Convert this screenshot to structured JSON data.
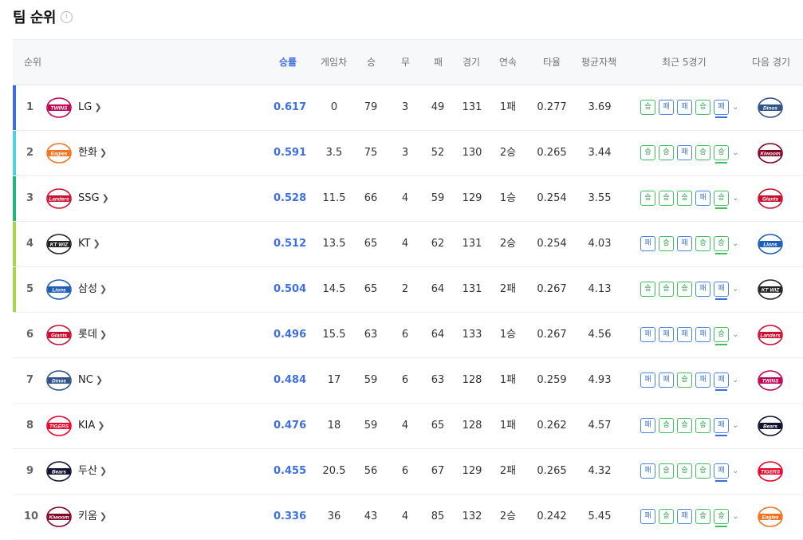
{
  "title": "팀 순위",
  "headers": {
    "rank": "순위",
    "pct": "승률",
    "gb": "게임차",
    "w": "승",
    "d": "무",
    "l": "패",
    "g": "경기",
    "streak": "연속",
    "avg": "타율",
    "era": "평균자책",
    "recent": "최근 5경기",
    "next": "다음 경기"
  },
  "win_label": "승",
  "loss_label": "패",
  "teams": [
    {
      "rank": "1",
      "name": "LG",
      "pct": "0.617",
      "gb": "0",
      "w": "79",
      "d": "3",
      "l": "49",
      "g": "131",
      "streak": "1패",
      "avg": "0.277",
      "era": "3.69",
      "logo": "TWINS",
      "next_logo": "Dinos"
    },
    {
      "rank": "2",
      "name": "한화",
      "pct": "0.591",
      "gb": "3.5",
      "w": "75",
      "d": "3",
      "l": "52",
      "g": "130",
      "streak": "2승",
      "avg": "0.265",
      "era": "3.44",
      "logo": "Eagles",
      "next_logo": "Kiwoom"
    },
    {
      "rank": "3",
      "name": "SSG",
      "pct": "0.528",
      "gb": "11.5",
      "w": "66",
      "d": "4",
      "l": "59",
      "g": "129",
      "streak": "1승",
      "avg": "0.254",
      "era": "3.55",
      "logo": "Landers",
      "next_logo": "Giants"
    },
    {
      "rank": "4",
      "name": "KT",
      "pct": "0.512",
      "gb": "13.5",
      "w": "65",
      "d": "4",
      "l": "62",
      "g": "131",
      "streak": "2승",
      "avg": "0.254",
      "era": "4.03",
      "logo": "KT WIZ",
      "next_logo": "Lions"
    },
    {
      "rank": "5",
      "name": "삼성",
      "pct": "0.504",
      "gb": "14.5",
      "w": "65",
      "d": "2",
      "l": "64",
      "g": "131",
      "streak": "2패",
      "avg": "0.267",
      "era": "4.13",
      "logo": "Lions",
      "next_logo": "KT WIZ"
    },
    {
      "rank": "6",
      "name": "롯데",
      "pct": "0.496",
      "gb": "15.5",
      "w": "63",
      "d": "6",
      "l": "64",
      "g": "133",
      "streak": "1승",
      "avg": "0.267",
      "era": "4.56",
      "logo": "Giants",
      "next_logo": "Landers"
    },
    {
      "rank": "7",
      "name": "NC",
      "pct": "0.484",
      "gb": "17",
      "w": "59",
      "d": "6",
      "l": "63",
      "g": "128",
      "streak": "1패",
      "avg": "0.259",
      "era": "4.93",
      "logo": "Dinos",
      "next_logo": "TWINS"
    },
    {
      "rank": "8",
      "name": "KIA",
      "pct": "0.476",
      "gb": "18",
      "w": "59",
      "d": "4",
      "l": "65",
      "g": "128",
      "streak": "1패",
      "avg": "0.262",
      "era": "4.57",
      "logo": "TIGERS",
      "next_logo": "Bears"
    },
    {
      "rank": "9",
      "name": "두산",
      "pct": "0.455",
      "gb": "20.5",
      "w": "56",
      "d": "6",
      "l": "67",
      "g": "129",
      "streak": "2패",
      "avg": "0.265",
      "era": "4.32",
      "logo": "Bears",
      "next_logo": "TIGERS"
    },
    {
      "rank": "10",
      "name": "키움",
      "pct": "0.336",
      "gb": "36",
      "w": "43",
      "d": "4",
      "l": "85",
      "g": "132",
      "streak": "2승",
      "avg": "0.242",
      "era": "5.45",
      "logo": "Kiwoom",
      "next_logo": "Eagles"
    }
  ],
  "recent_results": [
    [
      "W",
      "L",
      "L",
      "W",
      "L"
    ],
    [
      "W",
      "W",
      "L",
      "W",
      "W"
    ],
    [
      "W",
      "W",
      "W",
      "L",
      "W"
    ],
    [
      "L",
      "W",
      "L",
      "W",
      "W"
    ],
    [
      "W",
      "W",
      "W",
      "L",
      "L"
    ],
    [
      "L",
      "L",
      "L",
      "L",
      "W"
    ],
    [
      "L",
      "L",
      "W",
      "L",
      "L"
    ],
    [
      "L",
      "W",
      "W",
      "W",
      "L"
    ],
    [
      "L",
      "W",
      "W",
      "W",
      "L"
    ],
    [
      "L",
      "W",
      "L",
      "W",
      "W"
    ]
  ],
  "rank_bar_colors": [
    "#3c6ee0",
    "#4fd1e0",
    "#1fb87a",
    "#a5d64a",
    "#a5d64a",
    "",
    "",
    "",
    "",
    ""
  ],
  "logo_colors": {
    "TWINS": "#c30452",
    "Eagles": "#f37321",
    "Landers": "#ce0e2d",
    "KT WIZ": "#222222",
    "Lions": "#1d5fb8",
    "Giants": "#c8102e",
    "Dinos": "#315288",
    "TIGERS": "#ea0029",
    "Bears": "#131230",
    "Kiwoom": "#820024"
  }
}
